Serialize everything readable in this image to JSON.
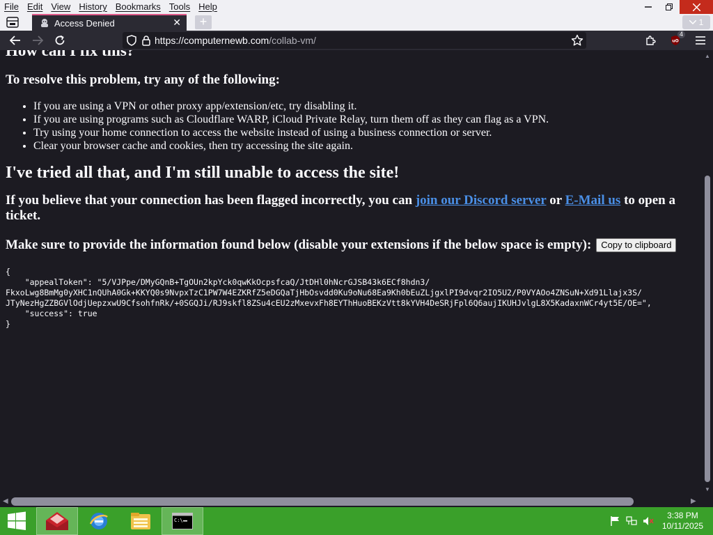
{
  "menubar": {
    "items": [
      {
        "label": "File"
      },
      {
        "label": "Edit"
      },
      {
        "label": "View"
      },
      {
        "label": "History"
      },
      {
        "label": "Bookmarks"
      },
      {
        "label": "Tools"
      },
      {
        "label": "Help"
      }
    ]
  },
  "tab": {
    "title": "Access Denied"
  },
  "tabs_count": "1",
  "url": {
    "host": "https://computernewb.com",
    "path": "/collab-vm/"
  },
  "extensions": {
    "ublock_count": "4"
  },
  "page": {
    "partial_heading": "How can I fix this?",
    "resolve_heading": "To resolve this problem, try any of the following:",
    "tips": [
      "If you are using a VPN or other proxy app/extension/etc, try disabling it.",
      "If you are using programs such as Cloudflare WARP, iCloud Private Relay, turn them off as they can flag as a VPN.",
      "Try using your home connection to access the website instead of using a business connection or server.",
      "Clear your browser cache and cookies, then try accessing the site again."
    ],
    "tried_heading": "I've tried all that, and I'm still unable to access the site!",
    "believe_prefix": "If you believe that your connection has been flagged incorrectly, you can ",
    "discord_link": "join our Discord server",
    "or_text": " or ",
    "email_link": "E-Mail us",
    "believe_suffix": " to open a ticket.",
    "info_text": "Make sure to provide the information found below (disable your extensions if the below space is empty):",
    "copy_button": "Copy to clipboard",
    "token_json": "{\n    \"appealToken\": \"5/VJPpe/DMyGQnB+TgOUn2kpYck0qwKkOcpsfcaQ/JtDHl0hNcrGJSB43k6ECf8hdn3/\nFkxoLwg8BmMg0yXHC1nQUhA0Gk+KKYQ0s9NvpxTzC1PW7W4EZKRfZ5eDGQaTjHbOsvdd0Ku9oNu68Ea9Kh0bEuZLjgxlPI9dvqr2IO5U2/P0VYAOo4ZNSuN+Xd91Llajx3S/\nJTyNezHgZZBGVlOdjUepzxwU9CfsohfnRk/+0SGQJi/RJ9skfl8ZSu4cEU2zMxevxFh8EYThHuoBEKzVtt8kYVH4DeSRjFpl6Q6aujIKUHJvlgL8X5KadaxnWCr4yt5E/OE=\",\n    \"success\": true\n}"
  },
  "taskbar": {
    "time": "3:38 PM",
    "date": "10/11/2025"
  },
  "colors": {
    "page_bg": "#1c1b22",
    "link": "#4a8fe6",
    "taskbar": "#3aa02a",
    "tab_accent": "#e05a8a",
    "close_red": "#c42b1c"
  }
}
